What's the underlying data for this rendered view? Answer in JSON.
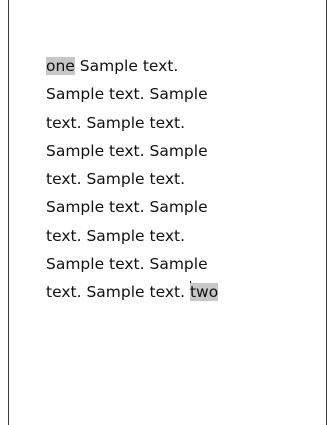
{
  "document": {
    "highlight_start": "one",
    "lines": [
      " Sample text.",
      "Sample text. Sample",
      "text. Sample text.",
      "Sample text. Sample",
      "text. Sample text.",
      "Sample text. Sample",
      "text. Sample text.",
      "Sample text. Sample",
      "text. Sample text. "
    ],
    "highlight_end": "two"
  }
}
